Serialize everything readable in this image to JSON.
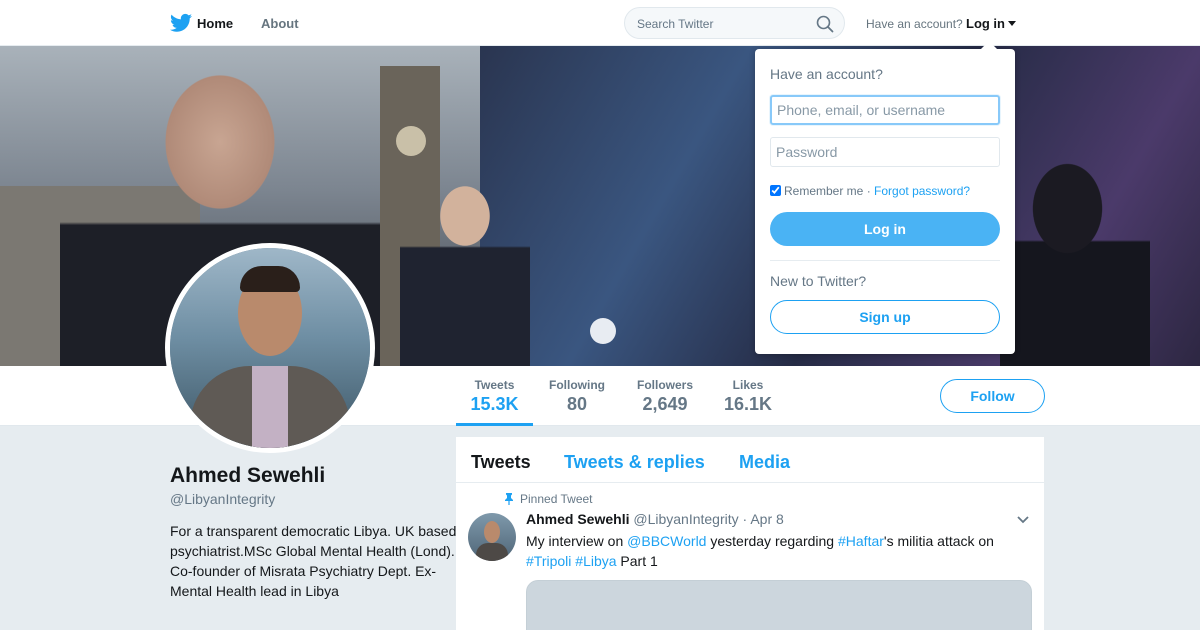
{
  "nav": {
    "home_label": "Home",
    "about_label": "About",
    "search_placeholder": "Search Twitter",
    "account_question": "Have an account?",
    "login_label": "Log in"
  },
  "icons": {
    "logo": "twitter-bird-icon",
    "search": "magnifier-icon",
    "pin": "pushpin-icon",
    "chevron": "chevron-down-icon"
  },
  "colors": {
    "accent": "#1da1f2",
    "login_button": "#4ab3f4",
    "page_bg": "#e6ecf0"
  },
  "stats": [
    {
      "label": "Tweets",
      "value": "15.3K"
    },
    {
      "label": "Following",
      "value": "80"
    },
    {
      "label": "Followers",
      "value": "2,649"
    },
    {
      "label": "Likes",
      "value": "16.1K"
    }
  ],
  "follow_label": "Follow",
  "profile": {
    "name": "Ahmed Sewehli",
    "handle": "@LibyanIntegrity",
    "bio": "For a transparent democratic Libya. UK based psychiatrist.MSc Global Mental Health (Lond). Co-founder of Misrata Psychiatry Dept. Ex-Mental Health lead in Libya"
  },
  "timeline": {
    "tabs": [
      "Tweets",
      "Tweets & replies",
      "Media"
    ]
  },
  "tweet": {
    "pinned_label": "Pinned Tweet",
    "fullname": "Ahmed Sewehli",
    "username": "@LibyanIntegrity",
    "separator": "·",
    "time": "Apr 8",
    "text_1": "My interview on ",
    "mention": "@BBCWorld",
    "text_2": " yesterday regarding ",
    "hashtag_1": "#Haftar",
    "text_3": "'s militia attack on ",
    "hashtag_2": "#Tripoli",
    "text_4": " ",
    "hashtag_3": "#Libya",
    "text_5": " Part 1"
  },
  "login_dropdown": {
    "title": "Have an account?",
    "username_placeholder": "Phone, email, or username",
    "password_placeholder": "Password",
    "remember_label": "Remember me",
    "remember_checked": true,
    "separator": "·",
    "forgot_label": "Forgot password?",
    "login_button": "Log in",
    "new_label": "New to Twitter?",
    "signup_button": "Sign up"
  }
}
